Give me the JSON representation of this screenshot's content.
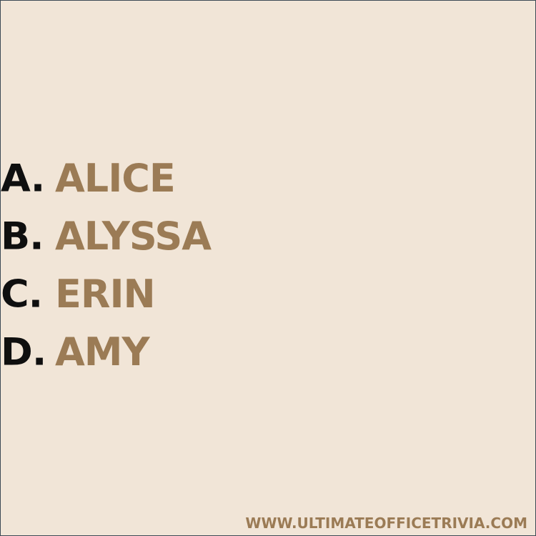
{
  "colors": {
    "background": "#f1e5d7",
    "letter": "#0f0f0f",
    "accent": "#9b7b55",
    "border": "#3d4a55"
  },
  "options": [
    {
      "letter": "A.",
      "answer": "ALICE"
    },
    {
      "letter": "B.",
      "answer": "ALYSSA"
    },
    {
      "letter": "C.",
      "answer": "ERIN"
    },
    {
      "letter": "D.",
      "answer": "AMY"
    }
  ],
  "footer": {
    "website": "WWW.ULTIMATEOFFICETRIVIA.COM"
  }
}
